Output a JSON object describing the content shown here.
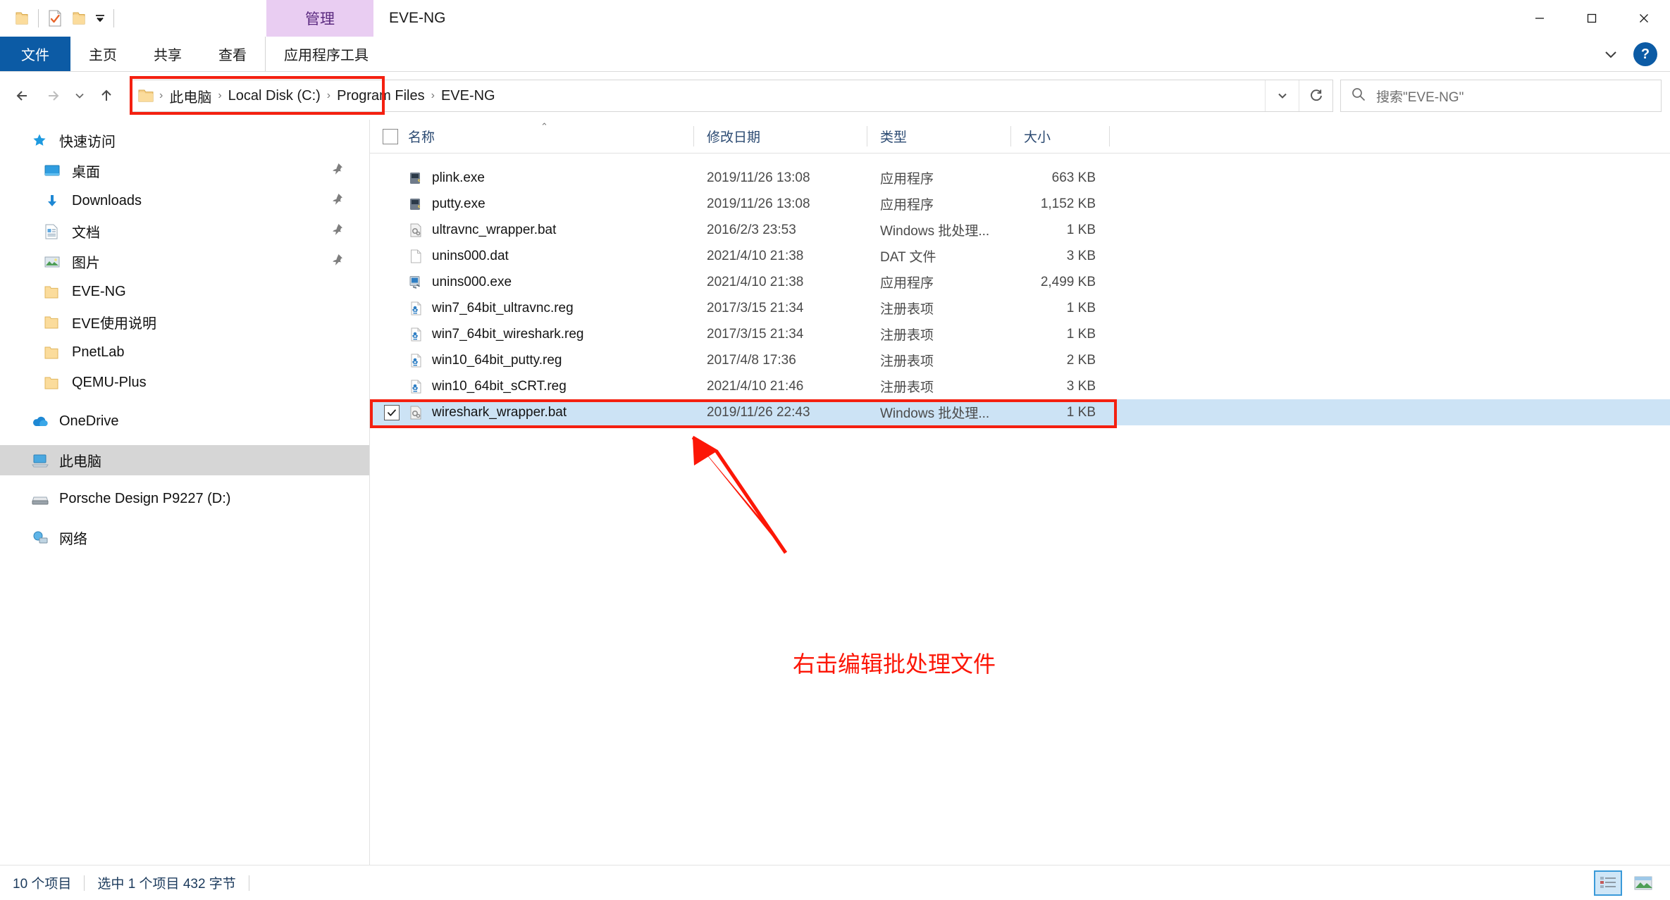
{
  "window": {
    "title": "EVE-NG",
    "contextual_tab": "管理",
    "minimize": "—",
    "maximize": "□",
    "close": "✕"
  },
  "quick_access_toolbar": {
    "items": [
      {
        "name": "folder-icon",
        "label": ""
      },
      {
        "name": "properties-checkmark-icon",
        "label": ""
      },
      {
        "name": "new-folder-icon",
        "label": ""
      },
      {
        "name": "customize-dropdown-icon",
        "label": "▼"
      }
    ]
  },
  "ribbon": {
    "tabs": [
      {
        "id": "file",
        "label": "文件"
      },
      {
        "id": "home",
        "label": "主页"
      },
      {
        "id": "share",
        "label": "共享"
      },
      {
        "id": "view",
        "label": "查看"
      },
      {
        "id": "app-tools",
        "label": "应用程序工具"
      }
    ],
    "expand_label": "⌄",
    "help_label": "?"
  },
  "address": {
    "back": "←",
    "forward": "→",
    "recent": "⌄",
    "up": "↑",
    "crumbs": [
      "此电脑",
      "Local Disk (C:)",
      "Program Files",
      "EVE-NG"
    ],
    "separator": "›",
    "dropdown": "⌄",
    "refresh": "↻"
  },
  "search": {
    "placeholder": "搜索\"EVE-NG\"",
    "value": "",
    "icon": "search-icon"
  },
  "sidebar": {
    "groups": [
      {
        "id": "quick-access",
        "label": "快速访问",
        "icon": "star-pin-icon",
        "items": [
          {
            "label": "桌面",
            "icon": "desktop-icon",
            "pinned": true
          },
          {
            "label": "Downloads",
            "icon": "downloads-icon",
            "pinned": true
          },
          {
            "label": "文档",
            "icon": "documents-icon",
            "pinned": true
          },
          {
            "label": "图片",
            "icon": "pictures-icon",
            "pinned": true
          },
          {
            "label": "EVE-NG",
            "icon": "folder-icon",
            "pinned": false
          },
          {
            "label": "EVE使用说明",
            "icon": "folder-icon",
            "pinned": false
          },
          {
            "label": "PnetLab",
            "icon": "folder-icon",
            "pinned": false
          },
          {
            "label": "QEMU-Plus",
            "icon": "folder-icon",
            "pinned": false
          }
        ]
      },
      {
        "id": "onedrive",
        "label": "OneDrive",
        "icon": "onedrive-icon",
        "items": []
      },
      {
        "id": "this-pc",
        "label": "此电脑",
        "icon": "this-pc-icon",
        "selected": true,
        "items": []
      },
      {
        "id": "drive-d",
        "label": "Porsche Design P9227 (D:)",
        "icon": "drive-icon",
        "items": []
      },
      {
        "id": "network",
        "label": "网络",
        "icon": "network-icon",
        "items": []
      }
    ]
  },
  "filelist": {
    "columns": [
      {
        "id": "name",
        "label": "名称",
        "sorted": true,
        "sort_dir": "asc"
      },
      {
        "id": "date",
        "label": "修改日期"
      },
      {
        "id": "type",
        "label": "类型"
      },
      {
        "id": "size",
        "label": "大小"
      }
    ],
    "sort_caret": "⌃",
    "rows": [
      {
        "name": "plink.exe",
        "date": "2019/11/26 13:08",
        "type": "应用程序",
        "size": "663 KB",
        "icon": "exe-plink-icon",
        "selected": false,
        "checked": false
      },
      {
        "name": "putty.exe",
        "date": "2019/11/26 13:08",
        "type": "应用程序",
        "size": "1,152 KB",
        "icon": "exe-putty-icon",
        "selected": false,
        "checked": false
      },
      {
        "name": "ultravnc_wrapper.bat",
        "date": "2016/2/3 23:53",
        "type": "Windows 批处理...",
        "size": "1 KB",
        "icon": "bat-icon",
        "selected": false,
        "checked": false
      },
      {
        "name": "unins000.dat",
        "date": "2021/4/10 21:38",
        "type": "DAT 文件",
        "size": "3 KB",
        "icon": "dat-icon",
        "selected": false,
        "checked": false
      },
      {
        "name": "unins000.exe",
        "date": "2021/4/10 21:38",
        "type": "应用程序",
        "size": "2,499 KB",
        "icon": "exe-uninstall-icon",
        "selected": false,
        "checked": false
      },
      {
        "name": "win7_64bit_ultravnc.reg",
        "date": "2017/3/15 21:34",
        "type": "注册表项",
        "size": "1 KB",
        "icon": "reg-icon",
        "selected": false,
        "checked": false
      },
      {
        "name": "win7_64bit_wireshark.reg",
        "date": "2017/3/15 21:34",
        "type": "注册表项",
        "size": "1 KB",
        "icon": "reg-icon",
        "selected": false,
        "checked": false
      },
      {
        "name": "win10_64bit_putty.reg",
        "date": "2017/4/8 17:36",
        "type": "注册表项",
        "size": "2 KB",
        "icon": "reg-icon",
        "selected": false,
        "checked": false
      },
      {
        "name": "win10_64bit_sCRT.reg",
        "date": "2021/4/10 21:46",
        "type": "注册表项",
        "size": "3 KB",
        "icon": "reg-icon",
        "selected": false,
        "checked": false
      },
      {
        "name": "wireshark_wrapper.bat",
        "date": "2019/11/26 22:43",
        "type": "Windows 批处理...",
        "size": "1 KB",
        "icon": "bat-icon",
        "selected": true,
        "checked": true
      }
    ]
  },
  "annotation": {
    "text": "右击编辑批处理文件",
    "color": "#fc1606",
    "arrow": "arrow-up-left-icon"
  },
  "statusbar": {
    "item_count": "10 个项目",
    "selection": "选中 1 个项目  432 字节",
    "views": [
      {
        "id": "details",
        "name": "details-view-icon",
        "active": true
      },
      {
        "id": "large-icons",
        "name": "large-icons-view-icon",
        "active": false
      }
    ]
  },
  "colors": {
    "accent": "#0c5ba5",
    "contextual_tab_bg": "#e9cdf2",
    "contextual_tab_text": "#5b2a80",
    "selection_bg": "#cce3f5",
    "sidebar_selection_bg": "#d6d6d6",
    "annotation_red": "#f42010",
    "header_text": "#2b4a72"
  }
}
